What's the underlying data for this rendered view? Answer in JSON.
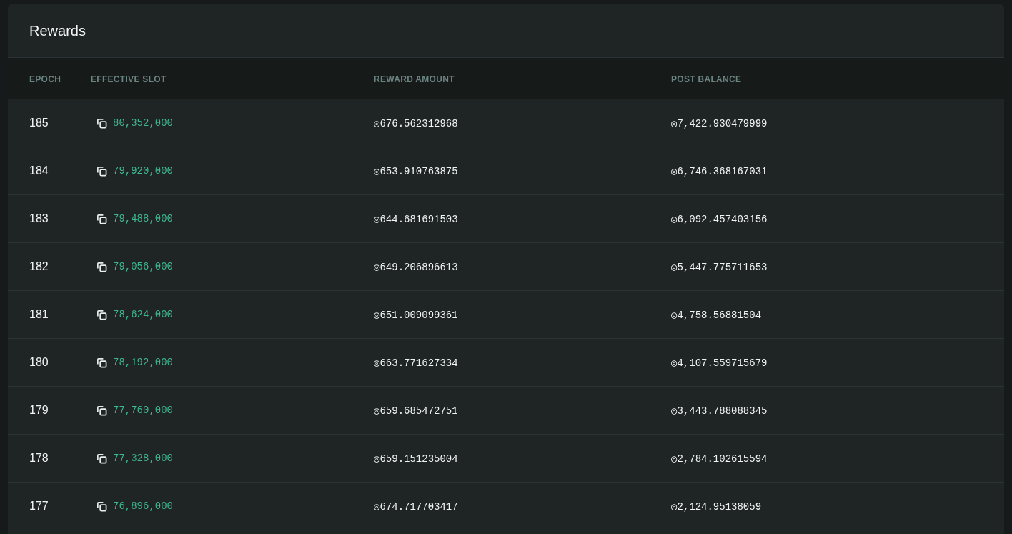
{
  "card": {
    "title": "Rewards"
  },
  "table": {
    "columns": [
      "EPOCH",
      "EFFECTIVE SLOT",
      "REWARD AMOUNT",
      "POST BALANCE"
    ],
    "rows": [
      {
        "epoch": "185",
        "slot": "80,352,000",
        "reward": "◎676.562312968",
        "balance": "◎7,422.930479999"
      },
      {
        "epoch": "184",
        "slot": "79,920,000",
        "reward": "◎653.910763875",
        "balance": "◎6,746.368167031"
      },
      {
        "epoch": "183",
        "slot": "79,488,000",
        "reward": "◎644.681691503",
        "balance": "◎6,092.457403156"
      },
      {
        "epoch": "182",
        "slot": "79,056,000",
        "reward": "◎649.206896613",
        "balance": "◎5,447.775711653"
      },
      {
        "epoch": "181",
        "slot": "78,624,000",
        "reward": "◎651.009099361",
        "balance": "◎4,758.56881504"
      },
      {
        "epoch": "180",
        "slot": "78,192,000",
        "reward": "◎663.771627334",
        "balance": "◎4,107.559715679"
      },
      {
        "epoch": "179",
        "slot": "77,760,000",
        "reward": "◎659.685472751",
        "balance": "◎3,443.788088345"
      },
      {
        "epoch": "178",
        "slot": "77,328,000",
        "reward": "◎659.151235004",
        "balance": "◎2,784.102615594"
      },
      {
        "epoch": "177",
        "slot": "76,896,000",
        "reward": "◎674.717703417",
        "balance": "◎2,124.95138059"
      }
    ]
  }
}
